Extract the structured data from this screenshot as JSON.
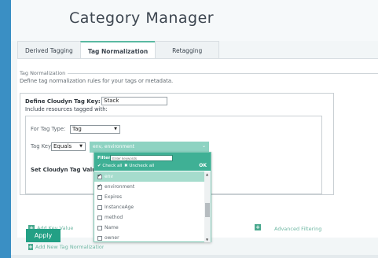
{
  "header": {
    "title": "Category Manager"
  },
  "tabs": [
    {
      "label": "Derived Tagging",
      "active": false
    },
    {
      "label": "Tag Normalization",
      "active": true
    },
    {
      "label": "Retagging",
      "active": false
    }
  ],
  "section": {
    "legend": "Tag Normalization",
    "description": "Define tag normalization rules for your tags or metadata."
  },
  "rule": {
    "define_key_label": "Define Cloudyn Tag Key:",
    "define_key_value": "Stack",
    "include_label": "Include resources tagged with:",
    "for_tag_type_label": "For Tag Type:",
    "tag_type_value": "Tag",
    "tag_key_label": "Tag Key",
    "operator_value": "Equals",
    "key_values_display": "env, environment",
    "set_value_label": "Set Cloudyn Tag Value"
  },
  "links": {
    "add_key_value": "Add Key Value",
    "advanced_filtering": "Advanced Filtering",
    "add_new_tag_normalization": "Add New Tag Normalization"
  },
  "apply_label": "Apply",
  "dropdown": {
    "filter_label": "Filter:",
    "filter_placeholder": "Enter keywords",
    "check_all": "✔ Check all",
    "uncheck_all": "✖ Uncheck all",
    "ok": "OK",
    "items": [
      {
        "label": "env",
        "checked": true,
        "highlighted": true
      },
      {
        "label": "environment",
        "checked": true,
        "highlighted": false
      },
      {
        "label": "Expires",
        "checked": false,
        "highlighted": false
      },
      {
        "label": "InstanceAge",
        "checked": false,
        "highlighted": false
      },
      {
        "label": "method",
        "checked": false,
        "highlighted": false
      },
      {
        "label": "Name",
        "checked": false,
        "highlighted": false
      },
      {
        "label": "owner",
        "checked": false,
        "highlighted": false
      }
    ]
  },
  "colors": {
    "background": "#3a8fc4",
    "accent": "#23a085",
    "dropdown_header": "#3fb095",
    "selected_row": "#a6dccd"
  }
}
